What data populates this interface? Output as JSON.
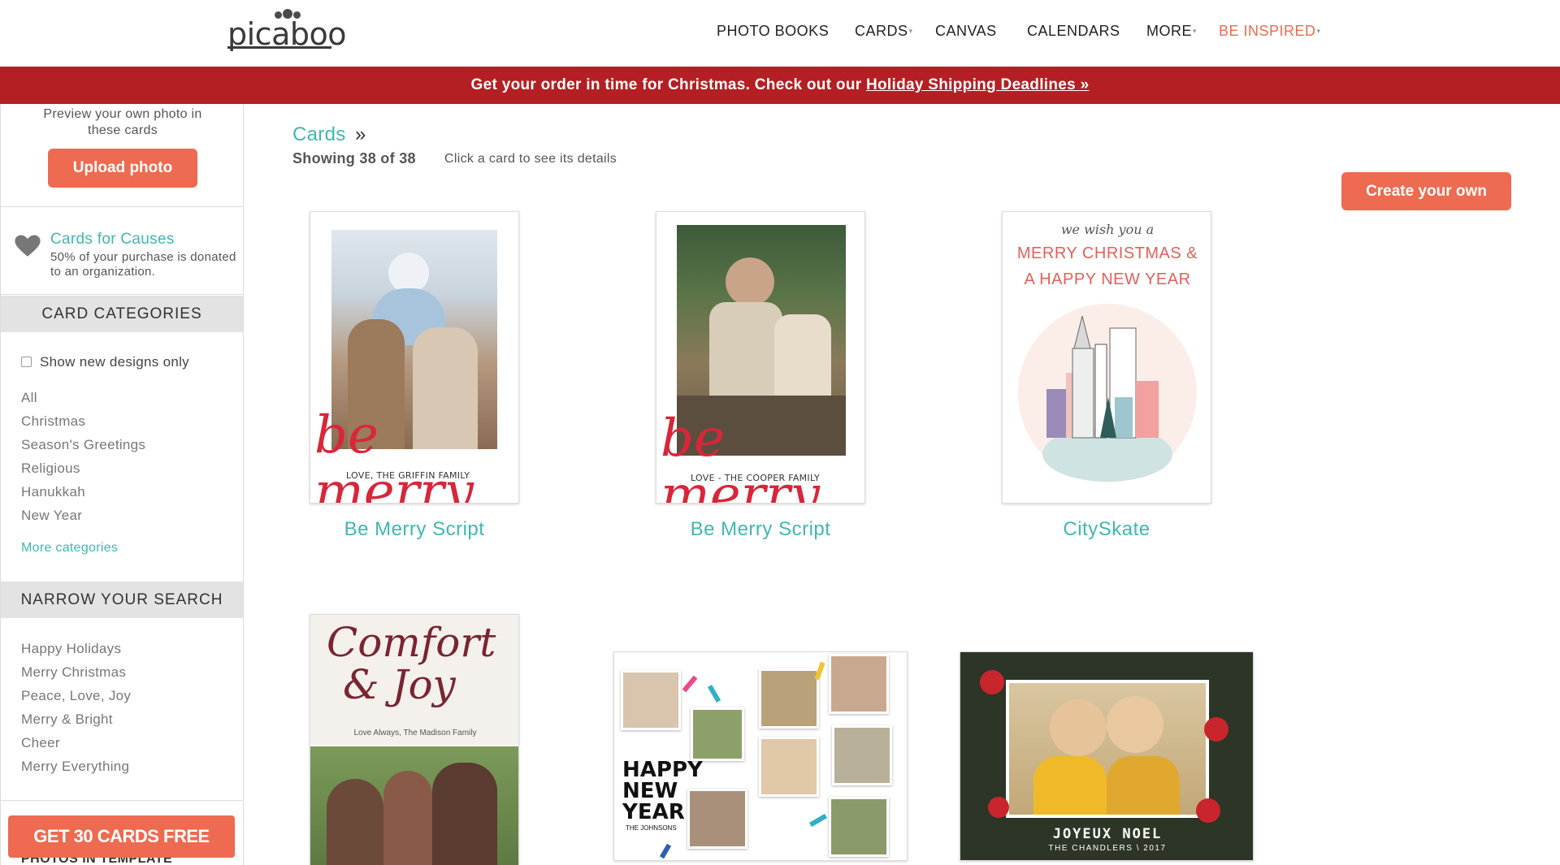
{
  "brand": {
    "logo_text": "picaboo"
  },
  "nav": {
    "items": [
      {
        "label": "PHOTO BOOKS",
        "caret": false
      },
      {
        "label": "CARDS",
        "caret": true
      },
      {
        "label": "CANVAS",
        "caret": false
      },
      {
        "label": "CALENDARS",
        "caret": false
      },
      {
        "label": "MORE",
        "caret": true
      },
      {
        "label": "BE INSPIRED",
        "caret": true
      }
    ]
  },
  "banner": {
    "text": "Get your order in time for Christmas. Check out our ",
    "link": "Holiday Shipping Deadlines »"
  },
  "sidebar": {
    "preview_text": "Preview your own photo in these cards",
    "upload_label": "Upload photo",
    "causes_title": "Cards for Causes",
    "causes_desc": "50% of your purchase is donated to an organization.",
    "categories_heading": "CARD CATEGORIES",
    "new_designs_label": "Show new designs only",
    "categories": [
      "All",
      "Christmas",
      "Season's Greetings",
      "Religious",
      "Hanukkah",
      "New Year"
    ],
    "more_categories": "More categories",
    "narrow_heading": "NARROW YOUR SEARCH",
    "narrow_items": [
      "Happy Holidays",
      "Merry Christmas",
      "Peace, Love, Joy",
      "Merry & Bright",
      "Cheer",
      "Merry Everything"
    ],
    "free_cards_label": "GET 30 CARDS FREE",
    "cutoff_text": "PHOTOS IN TEMPLATE"
  },
  "main": {
    "breadcrumb": "Cards",
    "breadcrumb_sep": "»",
    "showing": "Showing 38 of 38",
    "hint": "Click a card to see its details",
    "create_label": "Create your own",
    "cards": [
      {
        "title": "Be Merry Script",
        "script": "be merry",
        "signature": "LOVE, THE GRIFFIN FAMILY"
      },
      {
        "title": "Be Merry Script",
        "script": "be merry",
        "signature": "LOVE - THE COOPER FAMILY"
      },
      {
        "title": "CitySkate",
        "lines": [
          "we wish you a",
          "MERRY CHRISTMAS &",
          "A HAPPY NEW YEAR"
        ]
      },
      {
        "title": "",
        "script_lines": [
          "Comfort",
          "& Joy"
        ],
        "signature": "Love Always, The Madison Family"
      },
      {
        "title": "",
        "lines": [
          "HAPPY",
          "NEW",
          "YEAR"
        ],
        "signature": "THE JOHNSONS"
      },
      {
        "title": "",
        "lines": [
          "JOYEUX NOEL"
        ],
        "signature": "THE CHANDLERS \\ 2017"
      }
    ]
  },
  "colors": {
    "accent": "#ee6a50",
    "teal": "#3fb8b0",
    "banner": "#b41f23"
  }
}
